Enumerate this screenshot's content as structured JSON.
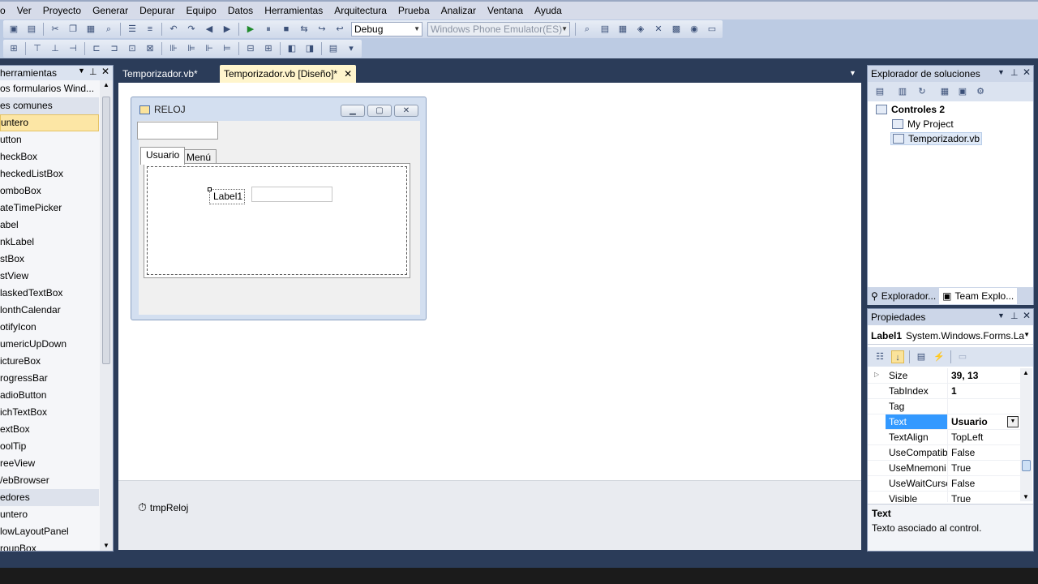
{
  "menu": [
    "o",
    "Ver",
    "Proyecto",
    "Generar",
    "Depurar",
    "Equipo",
    "Datos",
    "Herramientas",
    "Arquitectura",
    "Prueba",
    "Analizar",
    "Ventana",
    "Ayuda"
  ],
  "toolbar": {
    "config_combo": "Debug",
    "platform_combo": "Windows Phone Emulator(ES)"
  },
  "toolbox": {
    "title": "herramientas",
    "group_all": "os formularios Wind...",
    "items": [
      {
        "label": "es comunes",
        "kind": "cat"
      },
      {
        "label": "untero",
        "kind": "sel"
      },
      {
        "label": "utton",
        "kind": ""
      },
      {
        "label": "heckBox",
        "kind": ""
      },
      {
        "label": "heckedListBox",
        "kind": ""
      },
      {
        "label": "omboBox",
        "kind": ""
      },
      {
        "label": "ateTimePicker",
        "kind": ""
      },
      {
        "label": "abel",
        "kind": ""
      },
      {
        "label": "nkLabel",
        "kind": ""
      },
      {
        "label": "stBox",
        "kind": ""
      },
      {
        "label": "stView",
        "kind": ""
      },
      {
        "label": "laskedTextBox",
        "kind": ""
      },
      {
        "label": "lonthCalendar",
        "kind": ""
      },
      {
        "label": "otifyIcon",
        "kind": ""
      },
      {
        "label": "umericUpDown",
        "kind": ""
      },
      {
        "label": "ictureBox",
        "kind": ""
      },
      {
        "label": "rogressBar",
        "kind": ""
      },
      {
        "label": "adioButton",
        "kind": ""
      },
      {
        "label": "ichTextBox",
        "kind": ""
      },
      {
        "label": "extBox",
        "kind": ""
      },
      {
        "label": "oolTip",
        "kind": ""
      },
      {
        "label": "reeView",
        "kind": ""
      },
      {
        "label": "/ebBrowser",
        "kind": ""
      },
      {
        "label": "edores",
        "kind": "cat"
      },
      {
        "label": "untero",
        "kind": ""
      },
      {
        "label": "lowLayoutPanel",
        "kind": ""
      },
      {
        "label": "roupBox",
        "kind": ""
      }
    ]
  },
  "doc_tabs": [
    {
      "label": "Temporizador.vb*",
      "active": false
    },
    {
      "label": "Temporizador.vb [Diseño]*",
      "active": true
    }
  ],
  "form": {
    "title": "RELOJ",
    "tabs": [
      "Usuario",
      "Menú"
    ],
    "label1": "Label1"
  },
  "tray": {
    "component": "tmpReloj"
  },
  "solution_explorer": {
    "title": "Explorador de soluciones",
    "root": "Controles 2",
    "items": [
      "My Project",
      "Temporizador.vb"
    ],
    "bottom_tabs": [
      "Explorador...",
      "Team Explo..."
    ]
  },
  "properties": {
    "title": "Propiedades",
    "object_name": "Label1",
    "object_type": "System.Windows.Forms.La",
    "rows": [
      {
        "name": "Size",
        "value": "39, 13",
        "bold": true,
        "expand": true,
        "selected": false
      },
      {
        "name": "TabIndex",
        "value": "1",
        "bold": true,
        "expand": false,
        "selected": false
      },
      {
        "name": "Tag",
        "value": "",
        "bold": false,
        "expand": false,
        "selected": false
      },
      {
        "name": "Text",
        "value": "Usuario",
        "bold": true,
        "expand": false,
        "selected": true
      },
      {
        "name": "TextAlign",
        "value": "TopLeft",
        "bold": false,
        "expand": false,
        "selected": false
      },
      {
        "name": "UseCompatib",
        "value": "False",
        "bold": false,
        "expand": false,
        "selected": false
      },
      {
        "name": "UseMnemoni",
        "value": "True",
        "bold": false,
        "expand": false,
        "selected": false
      },
      {
        "name": "UseWaitCurso",
        "value": "False",
        "bold": false,
        "expand": false,
        "selected": false
      },
      {
        "name": "Visible",
        "value": "True",
        "bold": false,
        "expand": false,
        "selected": false
      }
    ],
    "desc_title": "Text",
    "desc_text": "Texto asociado al control."
  },
  "colors": {
    "ide_background": "#2b3c59",
    "selection": "#3399ff",
    "toolbox_selected": "#fce6a5"
  }
}
